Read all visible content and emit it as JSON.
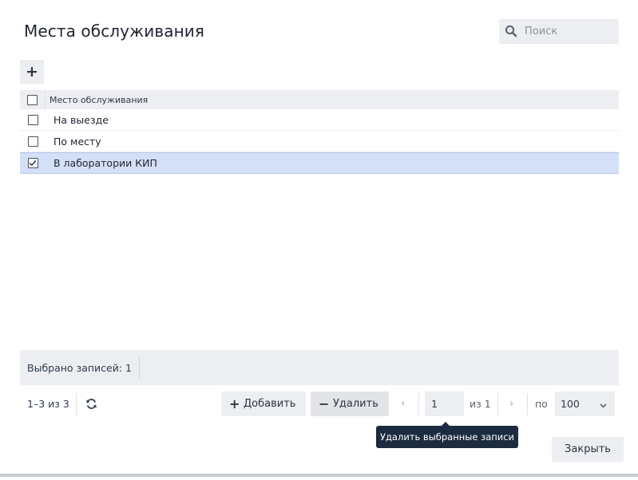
{
  "dialog": {
    "title": "Места обслуживания",
    "search": {
      "placeholder": "Поиск",
      "value": "",
      "icon": "search-icon"
    }
  },
  "toolbar": {
    "add_icon": "plus-icon",
    "add_symbol": "+"
  },
  "grid": {
    "header": {
      "column": "Место обслуживания",
      "all_checked": false
    },
    "rows": [
      {
        "label": "На выезде",
        "checked": false,
        "selected": false
      },
      {
        "label": "По месту",
        "checked": false,
        "selected": false
      },
      {
        "label": "В лаборатории КИП",
        "checked": true,
        "selected": true
      }
    ]
  },
  "status": {
    "selected_count_text": "Выбрано записей: 1"
  },
  "footer": {
    "range": "1–3 из 3",
    "add_label": "Добавить",
    "add_symbol": "+",
    "delete_label": "Удалить",
    "delete_symbol": "−",
    "prev_symbol": "‹",
    "next_symbol": "›",
    "page_value": "1",
    "of_pages": "из 1",
    "per_label": "по",
    "per_page": "100"
  },
  "tooltip": {
    "text": "Удалить выбранные записи"
  },
  "close_label": "Закрыть",
  "colors": {
    "selected_row": "#d4e0f8",
    "tooltip_bg": "#1c2b40",
    "panel_bg": "#eceef1"
  }
}
